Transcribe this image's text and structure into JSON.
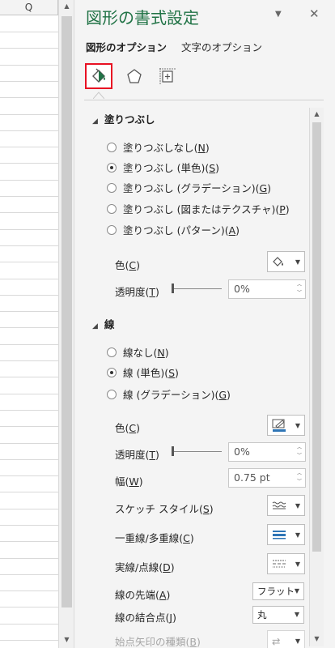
{
  "sheet": {
    "column_header": "Q"
  },
  "pane": {
    "title": "図形の書式設定",
    "dropdown_icon": "chevron-down-icon",
    "close_icon": "close-icon",
    "tabs": [
      {
        "label": "図形のオプション",
        "active": true
      },
      {
        "label": "文字のオプション",
        "active": false
      }
    ],
    "icon_tabs": [
      {
        "icon": "fill-line-icon",
        "selected": true
      },
      {
        "icon": "effects-icon",
        "selected": false
      },
      {
        "icon": "size-properties-icon",
        "selected": false
      }
    ],
    "fill": {
      "heading": "塗りつぶし",
      "options": [
        {
          "text": "塗りつぶしなし(",
          "key": "N",
          "end": ")",
          "selected": false
        },
        {
          "text": "塗りつぶし (単色)(",
          "key": "S",
          "end": ")",
          "selected": true
        },
        {
          "text": "塗りつぶし (グラデーション)(",
          "key": "G",
          "end": ")",
          "selected": false
        },
        {
          "text": "塗りつぶし (図またはテクスチャ)(",
          "key": "P",
          "end": ")",
          "selected": false
        },
        {
          "text": "塗りつぶし (パターン)(",
          "key": "A",
          "end": ")",
          "selected": false
        }
      ],
      "color_label": "色(",
      "color_key": "C",
      "color_end": ")",
      "transparency_label": "透明度(",
      "transparency_key": "T",
      "transparency_end": ")",
      "transparency_value": "0%",
      "transparency_fraction": 0
    },
    "line": {
      "heading": "線",
      "options": [
        {
          "text": "線なし(",
          "key": "N",
          "end": ")",
          "selected": false
        },
        {
          "text": "線 (単色)(",
          "key": "S",
          "end": ")",
          "selected": true
        },
        {
          "text": "線 (グラデーション)(",
          "key": "G",
          "end": ")",
          "selected": false
        }
      ],
      "color_label": "色(",
      "color_key": "C",
      "color_end": ")",
      "transparency_label": "透明度(",
      "transparency_key": "T",
      "transparency_end": ")",
      "transparency_value": "0%",
      "width_label": "幅(",
      "width_key": "W",
      "width_end": ")",
      "width_value": "0.75 pt",
      "sketch_label": "スケッチ スタイル(",
      "sketch_key": "S",
      "sketch_end": ")",
      "compound_label": "一重線/多重線(",
      "compound_key": "C",
      "compound_end": ")",
      "dash_label": "実線/点線(",
      "dash_key": "D",
      "dash_end": ")",
      "cap_label": "線の先端(",
      "cap_key": "A",
      "cap_end": ")",
      "cap_value": "フラット",
      "join_label": "線の結合点(",
      "join_key": "J",
      "join_end": ")",
      "join_value": "丸",
      "arrow_label": "始点矢印の種類(",
      "arrow_key": "B",
      "arrow_end": ")"
    },
    "colors": {
      "accent": "#217346",
      "selected_border": "#e81123",
      "line_color": "#2e75b6"
    }
  }
}
